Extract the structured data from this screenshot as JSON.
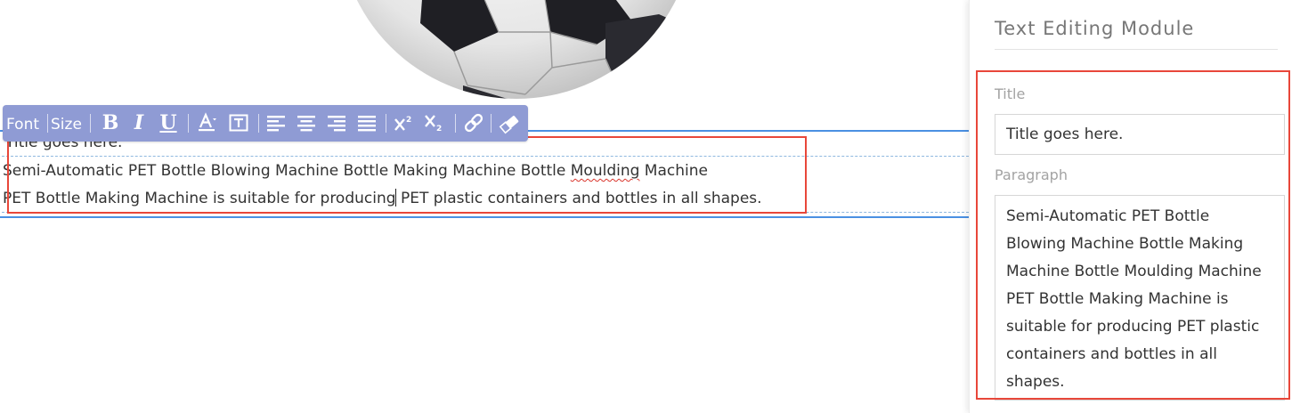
{
  "editor": {
    "title_text": "Title goes here.",
    "paragraph_line_1_before": "Semi-Automatic PET Bottle Blowing Machine Bottle Making Machine Bottle ",
    "paragraph_line_1_misspelled": "Moulding",
    "paragraph_line_1_after": " Machine",
    "paragraph_line_2_before_caret": "PET Bottle Making Machine is suitable for producing",
    "paragraph_line_2_after_caret": " PET plastic containers and bottles in all shapes.",
    "image_icon": "soccer-ball-image"
  },
  "toolbar": {
    "font_label": "Font",
    "size_label": "Size",
    "bold_glyph": "B",
    "italic_glyph": "I",
    "underline_glyph": "U",
    "icons": [
      "bold-icon",
      "italic-icon",
      "underline-icon",
      "font-color-icon",
      "text-box-icon",
      "align-left-icon",
      "align-center-icon",
      "align-right-icon",
      "align-justify-icon",
      "superscript-icon",
      "subscript-icon",
      "link-icon",
      "eraser-icon"
    ],
    "background_color": "#8f9bd4"
  },
  "panel": {
    "title": "Text Editing Module",
    "title_field_label": "Title",
    "title_field_value": "Title goes here.",
    "paragraph_field_label": "Paragraph",
    "paragraph_field_value": "Semi-Automatic PET Bottle Blowing Machine Bottle Making Machine Bottle Moulding Machine PET Bottle Making Machine is suitable for producing PET plastic containers and bottles in all shapes."
  },
  "colors": {
    "selection_blue": "#4a90e2",
    "highlight_red": "#e8473a",
    "spellcheck_red": "#d9342b"
  }
}
